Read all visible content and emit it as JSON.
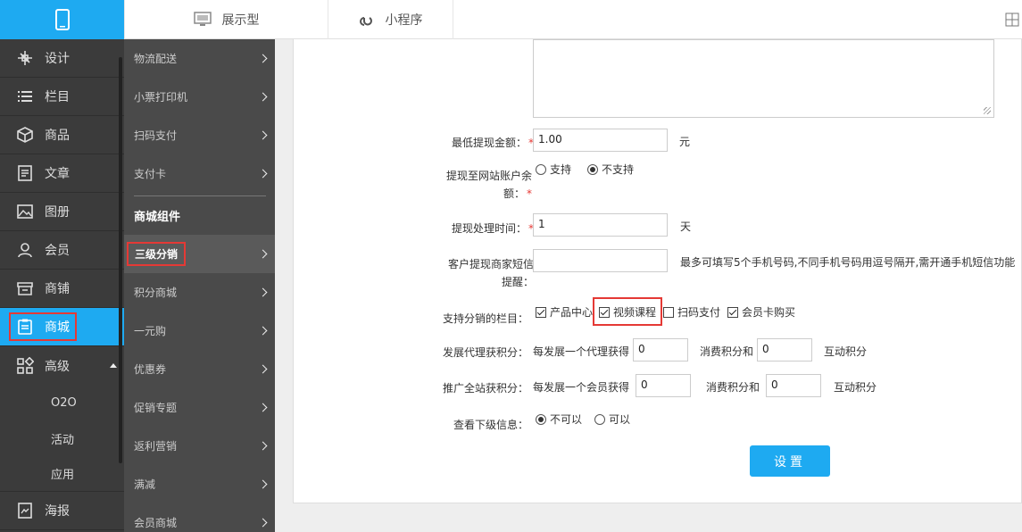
{
  "top": {
    "tabs": [
      {
        "label": "展示型",
        "icon": "monitor-icon"
      },
      {
        "label": "小程序",
        "icon": "mini-program-icon"
      }
    ]
  },
  "sidebar": {
    "items": [
      {
        "label": "设计",
        "icon": "design-icon"
      },
      {
        "label": "栏目",
        "icon": "list-icon"
      },
      {
        "label": "商品",
        "icon": "box-icon"
      },
      {
        "label": "文章",
        "icon": "document-icon"
      },
      {
        "label": "图册",
        "icon": "image-icon"
      },
      {
        "label": "会员",
        "icon": "user-icon"
      },
      {
        "label": "商铺",
        "icon": "shop-icon"
      },
      {
        "label": "商城",
        "icon": "clipboard-icon",
        "active": true
      },
      {
        "label": "高级",
        "icon": "grid-icon"
      }
    ],
    "sub_items": [
      "O2O",
      "活动",
      "应用"
    ],
    "bottom_item": {
      "label": "海报",
      "icon": "poster-icon"
    }
  },
  "sidebar2": {
    "group1": [
      "物流配送",
      "小票打印机",
      "扫码支付",
      "支付卡"
    ],
    "heading": "商城组件",
    "active": "三级分销",
    "group2": [
      "积分商城",
      "一元购",
      "优惠券",
      "促销专题",
      "返利营销",
      "满减",
      "会员商城"
    ]
  },
  "form": {
    "min_withdraw": {
      "label": "最低提现金额：",
      "value": "1.00",
      "unit": "元"
    },
    "withdraw_to_balance": {
      "label1": "提现至网站账户余",
      "label2": "额：",
      "options": [
        "支持",
        "不支持"
      ],
      "selected": 1
    },
    "process_time": {
      "label": "提现处理时间：",
      "value": "1",
      "unit": "天"
    },
    "sms_notify": {
      "label1": "客户提现商家短信",
      "label2": "提醒：",
      "value": "",
      "hint": "最多可填写5个手机号码,不同手机号码用逗号隔开,需开通手机短信功能"
    },
    "columns": {
      "label": "支持分销的栏目：",
      "options": [
        {
          "text": "产品中心",
          "checked": true
        },
        {
          "text": "视频课程",
          "checked": true
        },
        {
          "text": "扫码支付",
          "checked": false
        },
        {
          "text": "会员卡购买",
          "checked": true
        }
      ]
    },
    "agent_points": {
      "label": "发展代理获积分：",
      "prefix": "每发展一个代理获得",
      "value1": "0",
      "mid": "消费积分和",
      "value2": "0",
      "suffix": "互动积分"
    },
    "member_points": {
      "label": "推广全站获积分：",
      "prefix": "每发展一个会员获得",
      "value1": "0",
      "mid": "消费积分和",
      "value2": "0",
      "suffix": "互动积分"
    },
    "view_sub": {
      "label": "查看下级信息：",
      "options": [
        "不可以",
        "可以"
      ],
      "selected": 0
    },
    "required_mark": "*",
    "submit": "设置"
  },
  "colors": {
    "accent": "#1eaaf1",
    "highlight": "#e53935",
    "sidebar": "#3b3b3b"
  }
}
